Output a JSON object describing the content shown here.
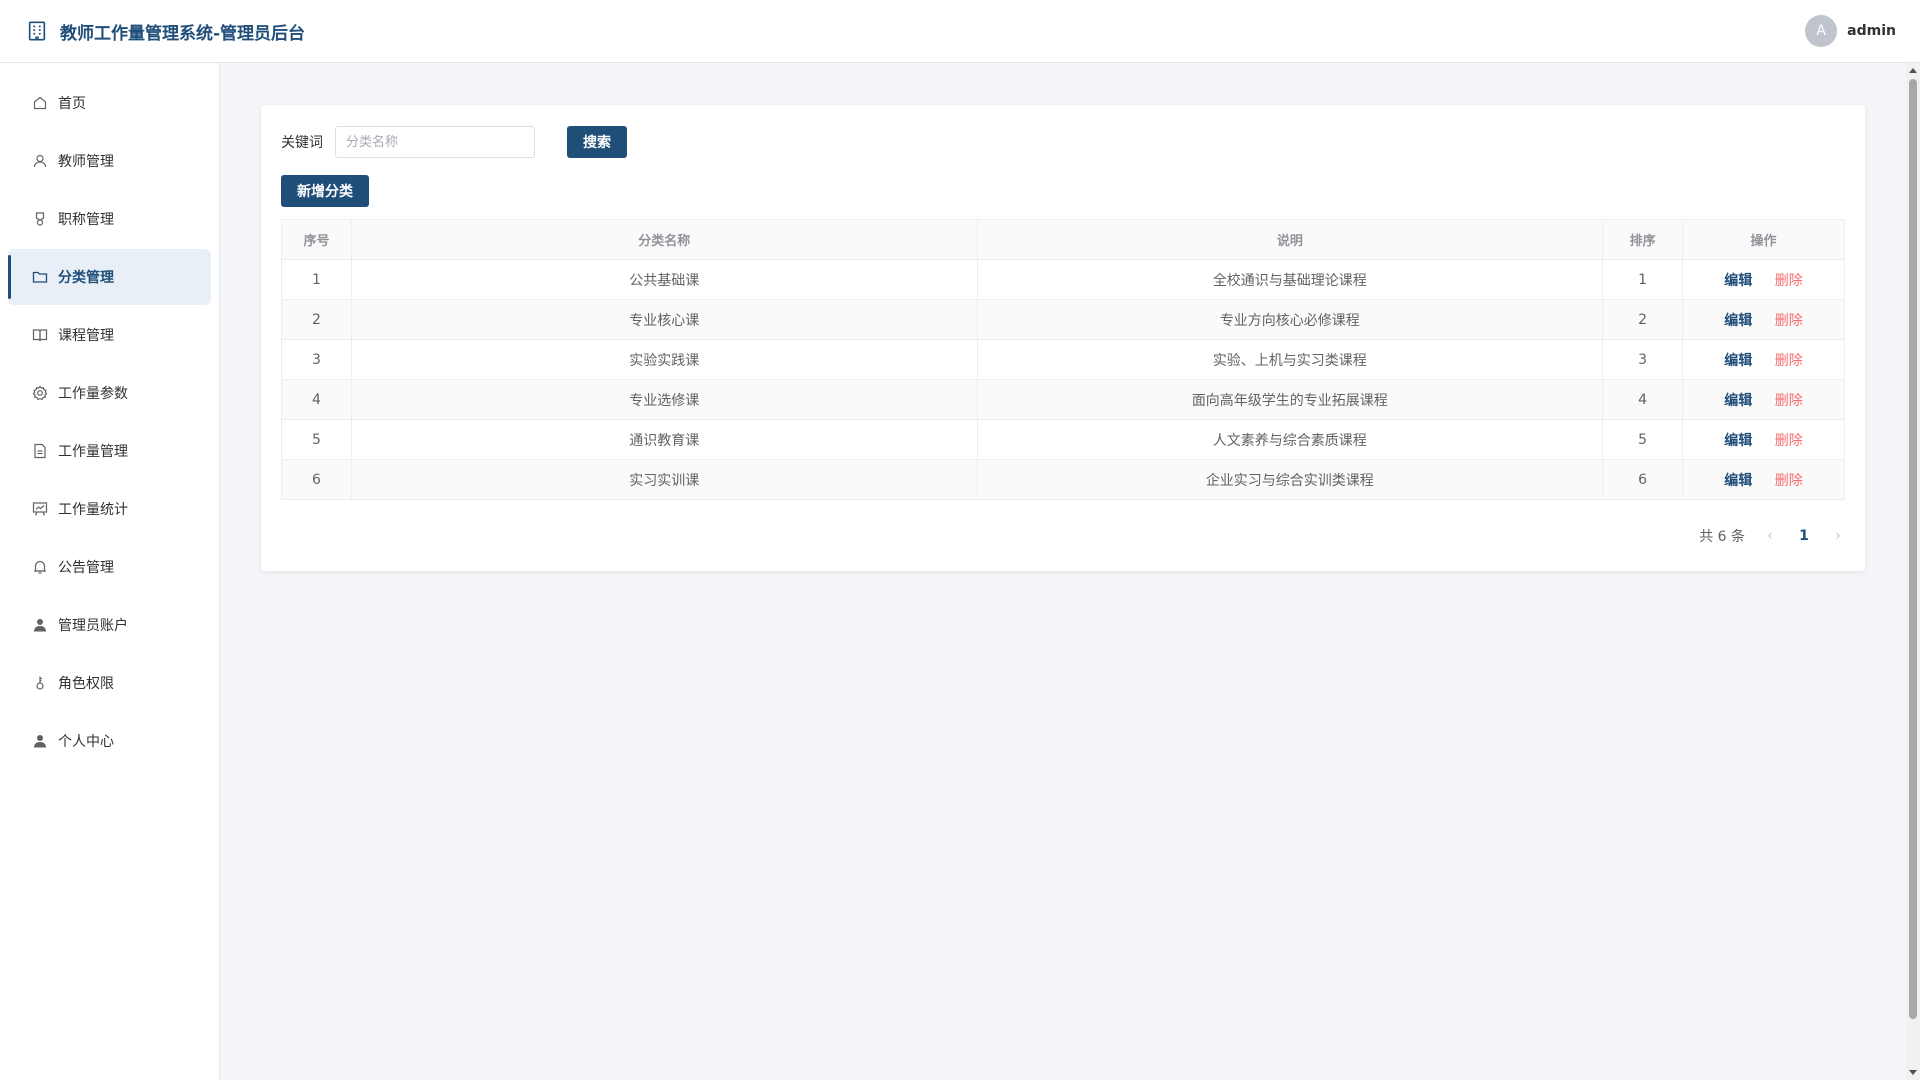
{
  "header": {
    "title": "教师工作量管理系统-管理员后台",
    "avatar_letter": "A",
    "username": "admin"
  },
  "sidebar": {
    "items": [
      {
        "label": "首页",
        "icon": "home-icon"
      },
      {
        "label": "教师管理",
        "icon": "user-icon"
      },
      {
        "label": "职称管理",
        "icon": "badge-icon"
      },
      {
        "label": "分类管理",
        "icon": "folder-icon",
        "active": true
      },
      {
        "label": "课程管理",
        "icon": "book-icon"
      },
      {
        "label": "工作量参数",
        "icon": "gear-icon"
      },
      {
        "label": "工作量管理",
        "icon": "document-icon"
      },
      {
        "label": "工作量统计",
        "icon": "chart-icon"
      },
      {
        "label": "公告管理",
        "icon": "bell-icon"
      },
      {
        "label": "管理员账户",
        "icon": "user-filled-icon"
      },
      {
        "label": "角色权限",
        "icon": "key-icon"
      },
      {
        "label": "个人中心",
        "icon": "user-filled-icon"
      }
    ]
  },
  "search": {
    "label": "关键词",
    "placeholder": "分类名称",
    "value": "",
    "button": "搜索"
  },
  "add_button": "新增分类",
  "table": {
    "headers": [
      "序号",
      "分类名称",
      "说明",
      "排序",
      "操作"
    ],
    "rows": [
      {
        "index": "1",
        "name": "公共基础课",
        "desc": "全校通识与基础理论课程",
        "order": "1"
      },
      {
        "index": "2",
        "name": "专业核心课",
        "desc": "专业方向核心必修课程",
        "order": "2"
      },
      {
        "index": "3",
        "name": "实验实践课",
        "desc": "实验、上机与实习类课程",
        "order": "3"
      },
      {
        "index": "4",
        "name": "专业选修课",
        "desc": "面向高年级学生的专业拓展课程",
        "order": "4"
      },
      {
        "index": "5",
        "name": "通识教育课",
        "desc": "人文素养与综合素质课程",
        "order": "5"
      },
      {
        "index": "6",
        "name": "实习实训课",
        "desc": "企业实习与综合实训类课程",
        "order": "6"
      }
    ],
    "edit_label": "编辑",
    "delete_label": "删除"
  },
  "pagination": {
    "total": "共 6 条",
    "current": "1"
  },
  "colors": {
    "primary": "#1f4e79",
    "danger": "#f56c6c",
    "active_bg": "#e8eff6"
  }
}
